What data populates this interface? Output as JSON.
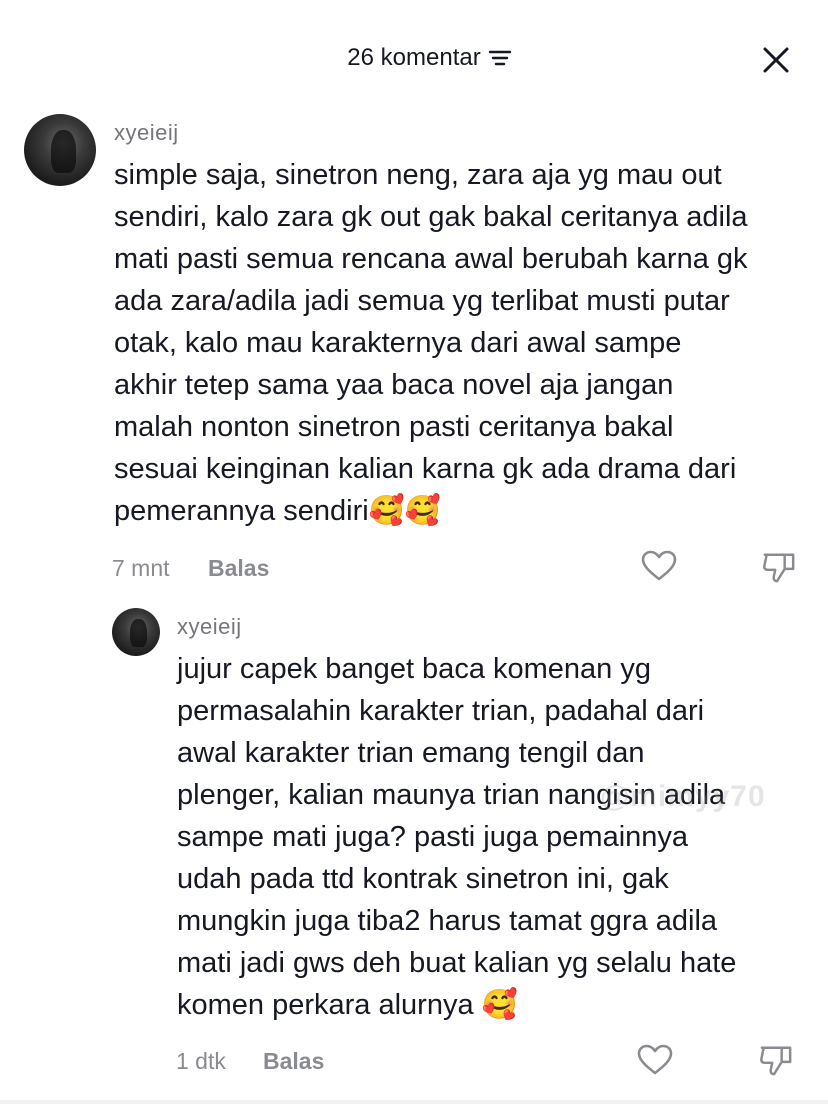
{
  "header": {
    "title": "26 komentar",
    "filter_icon": "filter-lines-icon",
    "close_icon": "close-icon"
  },
  "comments": [
    {
      "username": "xyeieij",
      "text": "simple saja, sinetron neng, zara aja yg mau out\nsendiri, kalo zara gk out gak bakal ceritanya adila\nmati pasti semua rencana awal berubah karna gk\nada zara/adila jadi semua yg terlibat musti putar\notak, kalo mau karakternya dari awal sampe\nakhir tetep sama yaa baca novel aja jangan\nmalah nonton sinetron pasti ceritanya bakal\nsesuai keinginan kalian karna gk ada drama dari\npemerannya sendiri🥰🥰",
      "time": "7 mnt",
      "reply_label": "Balas"
    },
    {
      "username": "xyeieij",
      "text": "jujur capek banget baca komenan yg\npermasalahin karakter trian, padahal dari\nawal karakter trian emang tengil dan\nplenger, kalian maunya trian nangisin adila\nsampe mati juga? pasti juga pemainnya\nudah pada ttd kontrak sinetron ini, gak\nmungkin juga tiba2 harus tamat ggra adila\nmati jadi gws deh buat kalian yg selalu hate\nkomen perkara alurnya 🥰",
      "time": "1 dtk",
      "reply_label": "Balas"
    }
  ],
  "watermark": "@mimyy70"
}
